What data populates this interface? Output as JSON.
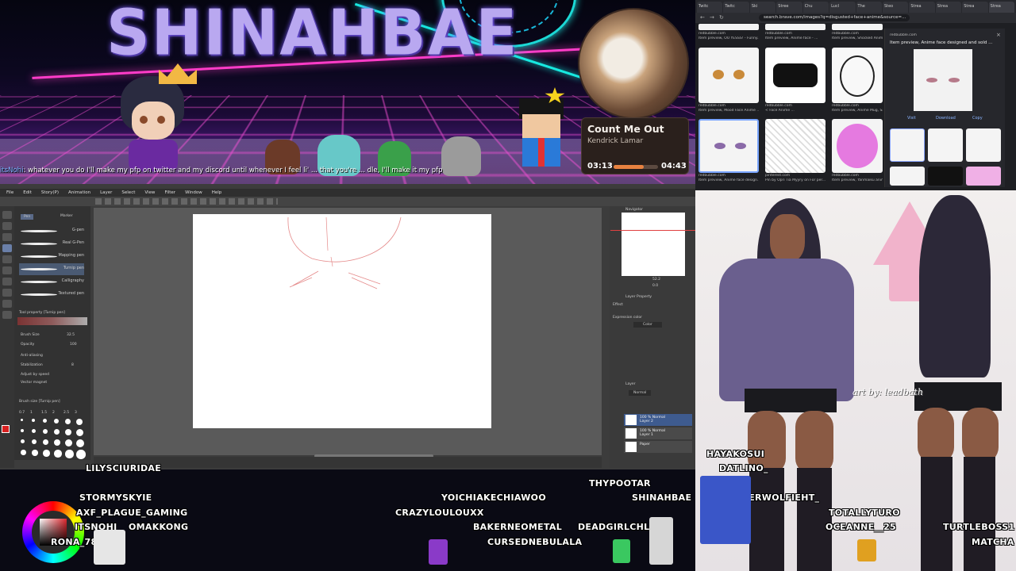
{
  "banner": {
    "title": "SHINAHBAE",
    "chat": {
      "user": "itsNohi",
      "message": ": whatever you do I'll make my pfp on twitter and my discord until whenever I feel li' ... that you're ... dle, I'll make it my pfp"
    }
  },
  "now_playing": {
    "song": "Count Me Out",
    "artist": "Kendrick Lamar",
    "elapsed": "03:13",
    "total": "04:43",
    "progress": 0.68
  },
  "browser": {
    "tabs": [
      "Twitc",
      "Twitc",
      "Ski",
      "Stree",
      "Chu",
      "Lucl",
      "The",
      "Steo",
      "Strea",
      "Strea",
      "Strea",
      "Strea"
    ],
    "url": "search.brave.com/images?q=disgusted+face+anime&source=...",
    "results_top": [
      "redbubble.com",
      "redbubble.com",
      "redbubble.com"
    ],
    "results_mid": [
      {
        "src": "redbubble.com",
        "title": "Item preview, Mood Face Anime ..."
      },
      {
        "src": "redbubble.com",
        "title": "< Face Anime ..."
      },
      {
        "src": "redbubble.com",
        "title": "Item preview, Anime Mug, Sar..."
      }
    ],
    "results_bot": [
      {
        "src": "redbubble.com",
        "title": "Item preview, Anime face design..."
      },
      {
        "src": "pinterest.com",
        "title": "Pin by Opri Tia Myyry on For per..."
      },
      {
        "src": "redbubble.com",
        "title": "Item preview, Yanmaiku anime..."
      }
    ],
    "top_caps": [
      "Item preview, OU YESSS! - Funny...",
      "Item preview, Anime face - ...",
      "Item preview, Shocked Anime..."
    ],
    "panel": {
      "source": "redbubble.com",
      "title": "Item preview, Anime face designed and sold ...",
      "visit": "Visit",
      "download": "Download",
      "copy": "Copy"
    }
  },
  "csp": {
    "menu": [
      "File",
      "Edit",
      "Story(P)",
      "Animation",
      "Layer",
      "Select",
      "View",
      "Filter",
      "Window",
      "Help"
    ],
    "subtool_tabs": [
      "Pen",
      "Marker"
    ],
    "brushes": [
      "G-pen",
      "Real G-Pen",
      "Mapping pen",
      "Turnip pen",
      "Calligraphy",
      "Textured pen"
    ],
    "tool_property_title": "Tool property [Turnip pen]",
    "brush_size_label": "Brush Size",
    "brush_size_value": "32.5",
    "opacity_label": "Opacity",
    "opacity_value": "100",
    "antialias_label": "Anti-aliasing",
    "stabilization_label": "Stabilization",
    "stab_value": "8",
    "adjust_speed": "Adjust by speed",
    "vector_magnet": "Vector magnet",
    "brush_size_panel": "Brush size [Turnip pen]",
    "brush_sizes": [
      "0.7",
      "1",
      "1.5",
      "2",
      "2.5",
      "3"
    ],
    "navigator": "Navigator",
    "layer_property": "Layer Property",
    "effect": "Effect",
    "expression_color": "Expression color",
    "expression_value": "Color",
    "layer_panel": "Layer",
    "blend_mode": "Normal",
    "layers": [
      {
        "name": "100 % Normal",
        "sub": "Layer 2",
        "selected": true
      },
      {
        "name": "100 % Normal",
        "sub": "Layer 1",
        "selected": false
      },
      {
        "name": "Paper",
        "sub": "",
        "selected": false
      }
    ],
    "zoom": "52.2",
    "rotation": "0.0"
  },
  "vtuber": {
    "credit": "art by: leadbath"
  },
  "usernames": [
    "LILYSCIURIDAE",
    "STORMYSKYIE",
    "AXF_PLAGUE_GAMING",
    "ITSNOHI",
    "OMAKKONG",
    "RONA_780",
    "YOICHIAKECHIAWOO",
    "CRAZYLOULOUXX",
    "BAKERNEOMETAL",
    "CURSEDNEBULALA",
    "DEADGIRLCHLOE",
    "THYPOOTAR",
    "SHINAHBAE",
    "HAYAKOSUI",
    "DATLINO_",
    "SILVERWOLFIEHT_",
    "TOTALLYTURO",
    "OCEANNE__25",
    "TURTLEBOSS1",
    "MATCHA"
  ],
  "colors": {
    "accent_pink": "#ff3cc8",
    "accent_cyan": "#17e8e0",
    "title_lavender": "#b9a8f0",
    "progress_orange": "#e88240",
    "csp_selection": "#3e5b8f"
  },
  "icons": [
    "crown-icon",
    "star-icon",
    "back-icon",
    "forward-icon",
    "reload-icon",
    "close-icon"
  ]
}
